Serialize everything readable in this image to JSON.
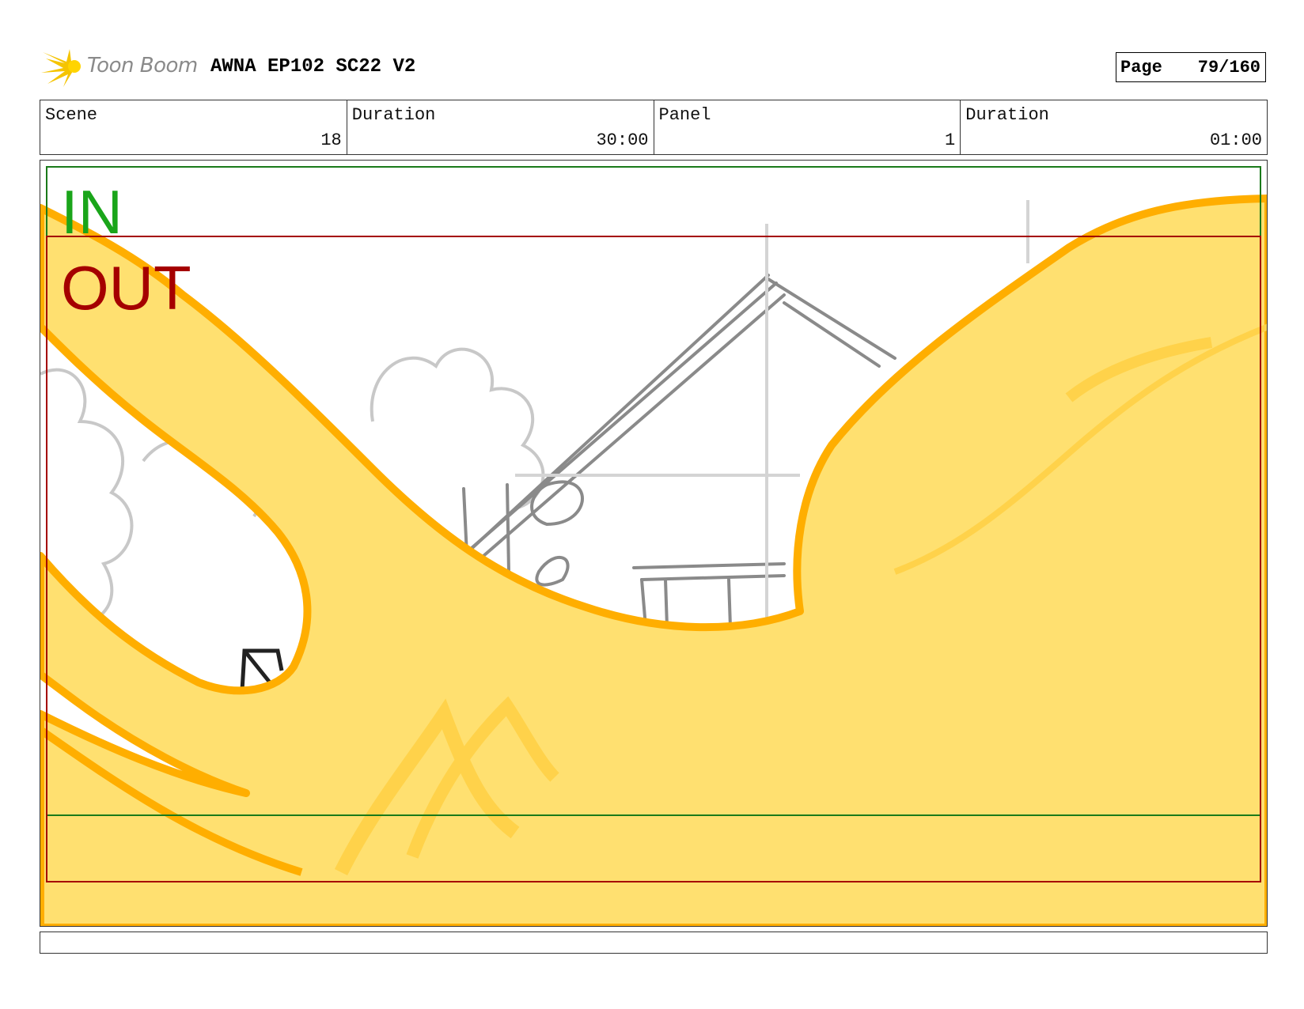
{
  "header": {
    "logo_text": "Toon Boom",
    "title": "AWNA EP102 SC22 V2",
    "page_label": "Page",
    "page_value": "79/160"
  },
  "info": {
    "scene_label": "Scene",
    "scene_value": "18",
    "scene_duration_label": "Duration",
    "scene_duration_value": "30:00",
    "panel_label": "Panel",
    "panel_value": "1",
    "panel_duration_label": "Duration",
    "panel_duration_value": "01:00"
  },
  "panel": {
    "in_label": "IN",
    "out_label": "OUT"
  },
  "notes": {
    "text": ""
  },
  "colors": {
    "in_frame": "#1aa51a",
    "out_frame": "#a50000",
    "fill": "#ffe070",
    "outline": "#ffae00",
    "sketch": "#8a8a8a"
  }
}
